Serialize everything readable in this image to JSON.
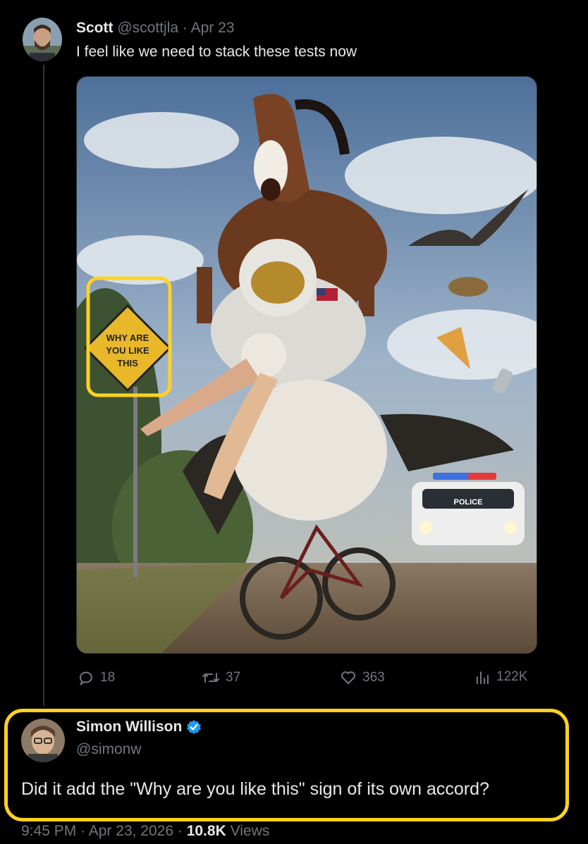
{
  "tweet": {
    "author_name": "Scott",
    "author_handle": "@scottjla",
    "separator": "·",
    "date": "Apr 23",
    "text": "I feel like we need to stack these tests now",
    "image": {
      "sign_lines": [
        "WHY ARE",
        "YOU LIKE",
        "THIS"
      ],
      "police_label": "POLICE"
    },
    "actions": {
      "replies": "18",
      "reposts": "37",
      "likes": "363",
      "views": "122K"
    }
  },
  "reply": {
    "author_name": "Simon Willison",
    "author_handle": "@simonw",
    "verified": true,
    "text": "Did it add the \"Why are you like this\" sign of its own accord?",
    "time": "9:45 PM",
    "separator": "·",
    "date": "Apr 23, 2026",
    "views_count": "10.8K",
    "views_label": "Views"
  },
  "colors": {
    "highlight": "#ffd21f",
    "verified": "#1d9bf0",
    "muted": "#71767b"
  }
}
